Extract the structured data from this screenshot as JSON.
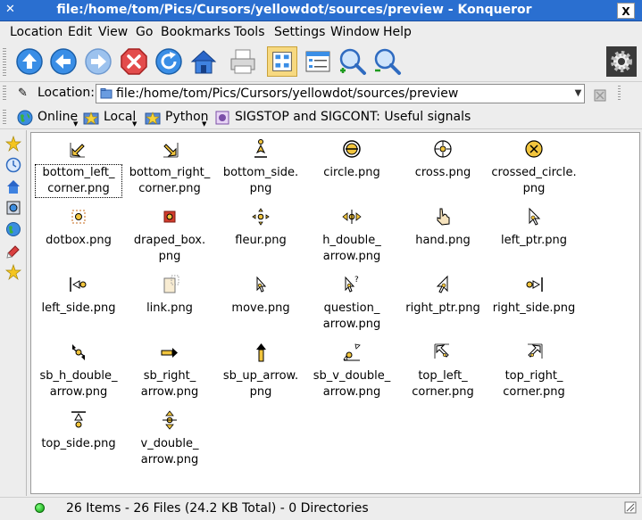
{
  "window": {
    "title": "file:/home/tom/Pics/Cursors/yellowdot/sources/preview - Konqueror",
    "close_label": "X"
  },
  "menu": [
    "Location",
    "Edit",
    "View",
    "Go",
    "Bookmarks",
    "Tools",
    "Settings",
    "Window",
    "Help"
  ],
  "toolbar": {
    "icons": [
      "up-arrow-icon",
      "back-icon",
      "forward-icon",
      "stop-icon",
      "reload-icon",
      "home-icon",
      "print-icon",
      "icon-view-icon",
      "detail-view-icon",
      "zoom-in-icon",
      "zoom-out-icon",
      "konqueror-gear-icon"
    ]
  },
  "location": {
    "label": "Location:",
    "value": "file:/home/tom/Pics/Cursors/yellowdot/sources/preview"
  },
  "bookmarks": [
    {
      "label": "Online",
      "icon": "globe-icon"
    },
    {
      "label": "Local",
      "icon": "star-folder-icon"
    },
    {
      "label": "Python",
      "icon": "star-folder-icon"
    },
    {
      "label": "SIGSTOP and SIGCONT: Useful signals",
      "icon": "web-page-icon"
    }
  ],
  "files": [
    {
      "name": "bottom_left_\ncorner.png",
      "icon": "bottom-left-corner-cursor-icon"
    },
    {
      "name": "bottom_right_\ncorner.png",
      "icon": "bottom-right-corner-cursor-icon"
    },
    {
      "name": "bottom_side.\npng",
      "icon": "bottom-side-cursor-icon"
    },
    {
      "name": "circle.png",
      "icon": "circle-cursor-icon"
    },
    {
      "name": "cross.png",
      "icon": "cross-cursor-icon"
    },
    {
      "name": "crossed_circle.\npng",
      "icon": "crossed-circle-cursor-icon"
    },
    {
      "name": "dotbox.png",
      "icon": "dotbox-cursor-icon"
    },
    {
      "name": "draped_box.\npng",
      "icon": "draped-box-cursor-icon"
    },
    {
      "name": "fleur.png",
      "icon": "fleur-cursor-icon"
    },
    {
      "name": "h_double_\narrow.png",
      "icon": "h-double-arrow-cursor-icon"
    },
    {
      "name": "hand.png",
      "icon": "hand-cursor-icon"
    },
    {
      "name": "left_ptr.png",
      "icon": "left-ptr-cursor-icon"
    },
    {
      "name": "left_side.png",
      "icon": "left-side-cursor-icon"
    },
    {
      "name": "link.png",
      "icon": "link-cursor-icon"
    },
    {
      "name": "move.png",
      "icon": "move-cursor-icon"
    },
    {
      "name": "question_\narrow.png",
      "icon": "question-arrow-cursor-icon"
    },
    {
      "name": "right_ptr.png",
      "icon": "right-ptr-cursor-icon"
    },
    {
      "name": "right_side.png",
      "icon": "right-side-cursor-icon"
    },
    {
      "name": "sb_h_double_\narrow.png",
      "icon": "sb-h-double-arrow-cursor-icon"
    },
    {
      "name": "sb_right_\narrow.png",
      "icon": "sb-right-arrow-cursor-icon"
    },
    {
      "name": "sb_up_arrow.\npng",
      "icon": "sb-up-arrow-cursor-icon"
    },
    {
      "name": "sb_v_double_\narrow.png",
      "icon": "sb-v-double-arrow-cursor-icon"
    },
    {
      "name": "top_left_\ncorner.png",
      "icon": "top-left-corner-cursor-icon"
    },
    {
      "name": "top_right_\ncorner.png",
      "icon": "top-right-corner-cursor-icon"
    },
    {
      "name": "top_side.png",
      "icon": "top-side-cursor-icon"
    },
    {
      "name": "v_double_\narrow.png",
      "icon": "v-double-arrow-cursor-icon"
    }
  ],
  "status": {
    "text": "26 Items - 26 Files (24.2 KB Total) - 0 Directories"
  },
  "colors": {
    "titlebar": "#2a6fd0",
    "cursor_fill": "#f2c53d",
    "cursor_stroke": "#000000"
  }
}
